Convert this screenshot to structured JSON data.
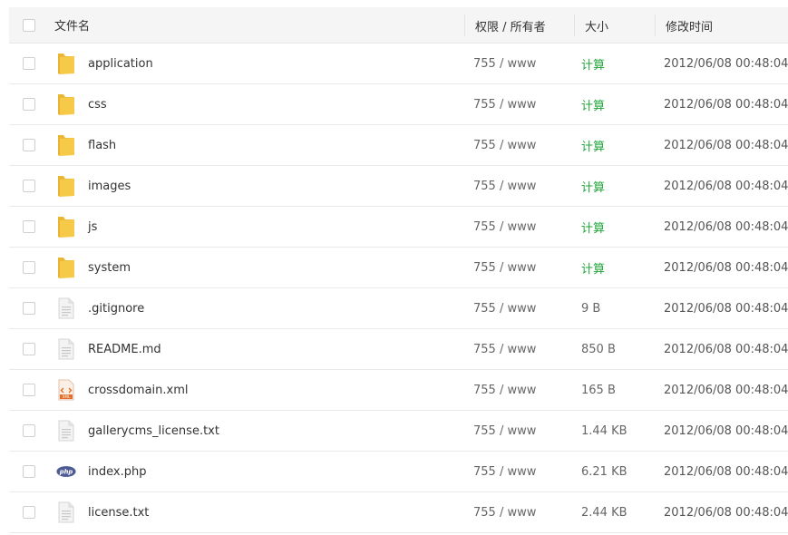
{
  "header": {
    "col_name": "文件名",
    "col_perm": "权限 / 所有者",
    "col_size": "大小",
    "col_time": "修改时间"
  },
  "colors": {
    "calc": "#20a53a",
    "folder": "#f7c948"
  },
  "files": [
    {
      "name": "application",
      "icon": "folder-icon",
      "perm": "755 / www",
      "size": "计算",
      "time": "2012/06/08 00:48:04"
    },
    {
      "name": "css",
      "icon": "folder-icon",
      "perm": "755 / www",
      "size": "计算",
      "time": "2012/06/08 00:48:04"
    },
    {
      "name": "flash",
      "icon": "folder-icon",
      "perm": "755 / www",
      "size": "计算",
      "time": "2012/06/08 00:48:04"
    },
    {
      "name": "images",
      "icon": "folder-icon",
      "perm": "755 / www",
      "size": "计算",
      "time": "2012/06/08 00:48:04"
    },
    {
      "name": "js",
      "icon": "folder-icon",
      "perm": "755 / www",
      "size": "计算",
      "time": "2012/06/08 00:48:04"
    },
    {
      "name": "system",
      "icon": "folder-icon",
      "perm": "755 / www",
      "size": "计算",
      "time": "2012/06/08 00:48:04"
    },
    {
      "name": ".gitignore",
      "icon": "text-file-icon",
      "perm": "755 / www",
      "size": "9 B",
      "time": "2012/06/08 00:48:04"
    },
    {
      "name": "README.md",
      "icon": "text-file-icon",
      "perm": "755 / www",
      "size": "850 B",
      "time": "2012/06/08 00:48:04"
    },
    {
      "name": "crossdomain.xml",
      "icon": "xml-file-icon",
      "perm": "755 / www",
      "size": "165 B",
      "time": "2012/06/08 00:48:04"
    },
    {
      "name": "gallerycms_license.txt",
      "icon": "text-file-icon",
      "perm": "755 / www",
      "size": "1.44 KB",
      "time": "2012/06/08 00:48:04"
    },
    {
      "name": "index.php",
      "icon": "php-file-icon",
      "perm": "755 / www",
      "size": "6.21 KB",
      "time": "2012/06/08 00:48:04"
    },
    {
      "name": "license.txt",
      "icon": "text-file-icon",
      "perm": "755 / www",
      "size": "2.44 KB",
      "time": "2012/06/08 00:48:04"
    }
  ]
}
